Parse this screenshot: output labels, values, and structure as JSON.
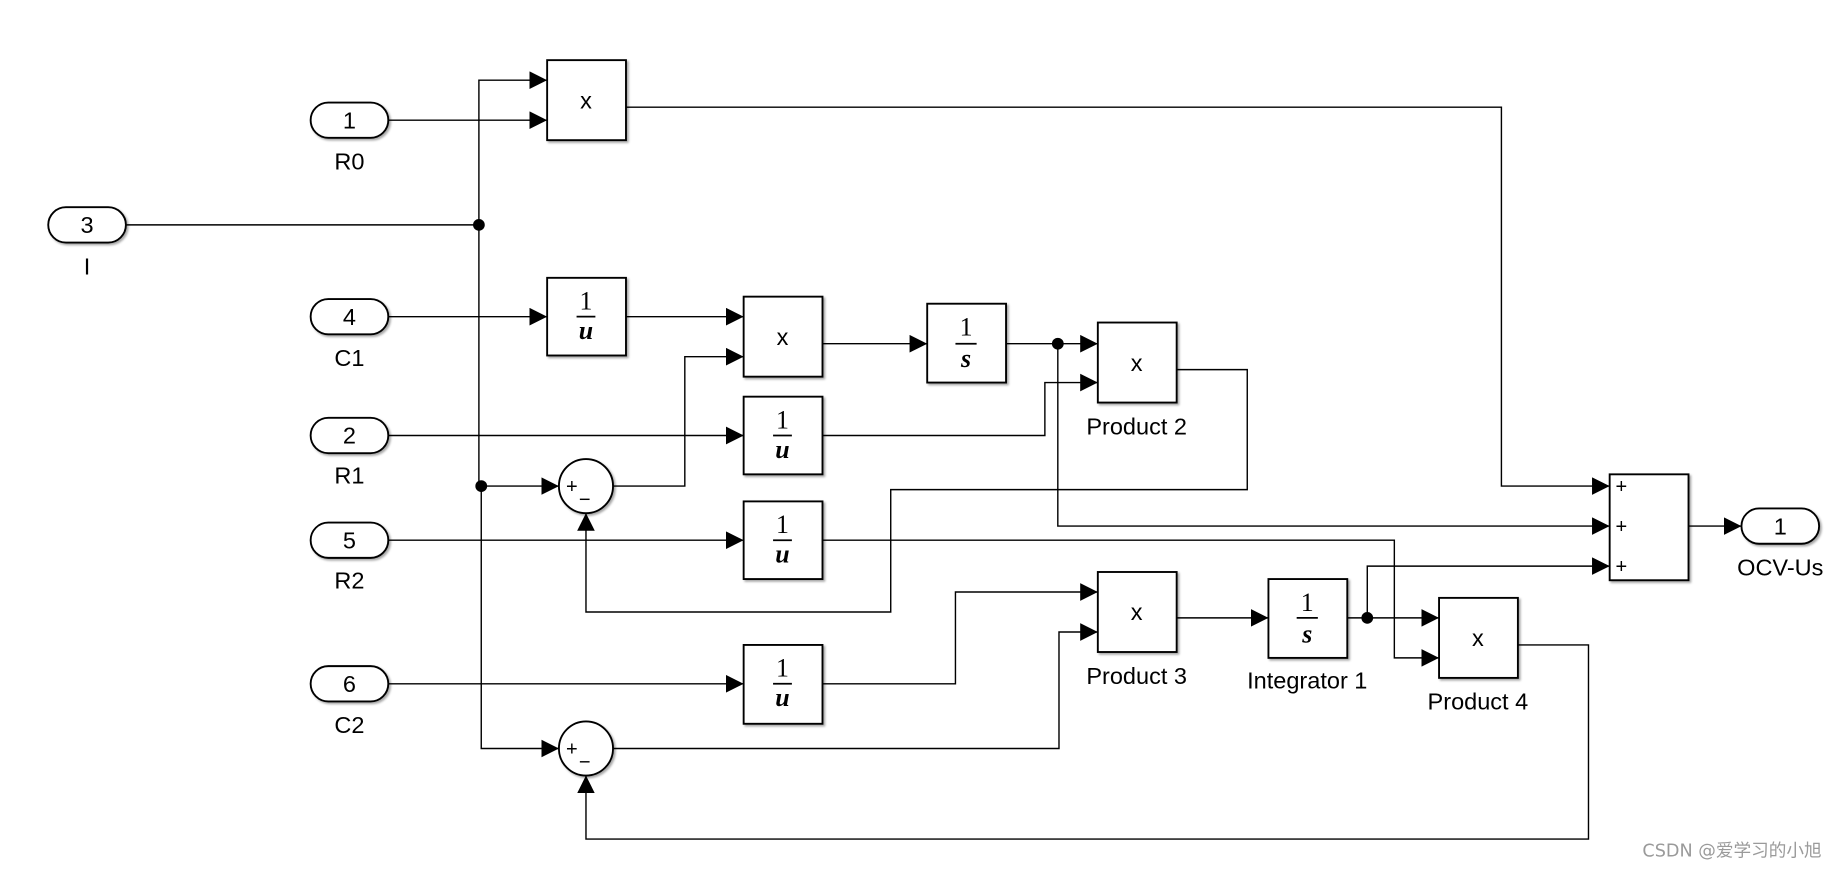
{
  "inports": [
    {
      "number": "1",
      "label": "R0"
    },
    {
      "number": "3",
      "label": "I"
    },
    {
      "number": "4",
      "label": "C1"
    },
    {
      "number": "2",
      "label": "R1"
    },
    {
      "number": "5",
      "label": "R2"
    },
    {
      "number": "6",
      "label": "C2"
    }
  ],
  "outport": {
    "number": "1",
    "label": "OCV-Us"
  },
  "blocks": {
    "product_symbol": "x",
    "reciprocal": {
      "num": "1",
      "den": "u"
    },
    "integrator": {
      "num": "1",
      "den": "s"
    },
    "product2_label": "Product 2",
    "product3_label": "Product 3",
    "integrator1_label": "Integrator 1",
    "product4_label": "Product 4",
    "sum_signs": [
      "+",
      "+",
      "+"
    ],
    "subtract_signs": {
      "plus": "+",
      "minus": "−"
    }
  },
  "watermark": "CSDN @爱学习的小旭",
  "colors": {
    "line": "#000000",
    "background": "#ffffff",
    "watermark": "#9a9a9a"
  }
}
